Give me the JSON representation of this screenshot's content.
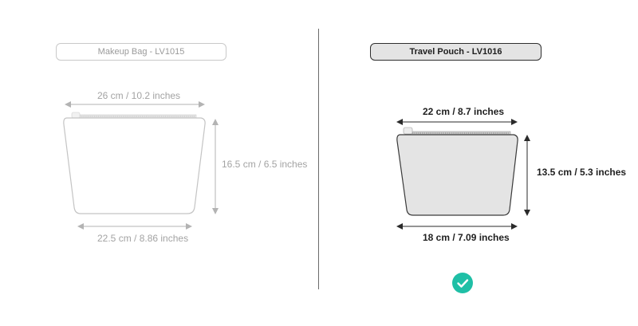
{
  "left_product": {
    "title": "Makeup Bag - LV1015",
    "top_width": "26 cm /  10.2 inches",
    "height": "16.5 cm / 6.5 inches",
    "bottom_width": "22.5 cm /  8.86 inches"
  },
  "right_product": {
    "title": "Travel Pouch - LV1016",
    "top_width": "22 cm / 8.7 inches",
    "height": "13.5 cm / 5.3 inches",
    "bottom_width": "18 cm / 7.09 inches",
    "selected_icon": "check-circle-icon"
  },
  "colors": {
    "check_accent": "#1fbfa6",
    "selected_fill": "#e4e4e4"
  }
}
